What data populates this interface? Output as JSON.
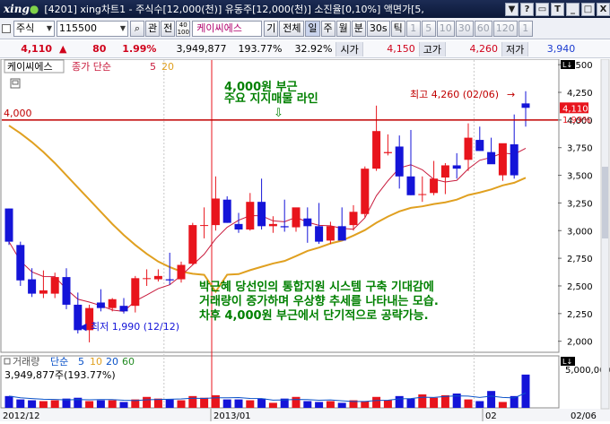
{
  "window": {
    "logo": "xing",
    "title": "[4201] xing차트1 - 주식수[12,000(천)] 유동주[12,000(천)] 소진율[0,10%] 액면가[5,",
    "buttons": [
      "▼",
      "?",
      "▭",
      "T",
      "_",
      "□",
      "X"
    ]
  },
  "toolbar": {
    "market": "주식",
    "code": "115500",
    "btn_related": "관",
    "btn_chart": "전",
    "stock_name": "케이씨에스",
    "btn_gi": "기",
    "btn_all": "전체",
    "periods": [
      "일",
      "주",
      "월",
      "분",
      "30s",
      "틱"
    ],
    "intervals": [
      "1",
      "5",
      "10",
      "30",
      "60",
      "120",
      "1"
    ],
    "count_top": "40",
    "count_bottom": "100"
  },
  "pricebar": {
    "price": "4,110",
    "arrow": "▲",
    "change": "80",
    "change_pct": "1.99%",
    "volume": "3,949,877",
    "vol_ratio": "193.77%",
    "ratio2": "32.92%",
    "open_label": "시가",
    "open": "4,150",
    "high_label": "고가",
    "high": "4,260",
    "low_label": "저가",
    "low": "3,940"
  },
  "chart_header": {
    "name": "케이씨에스",
    "ma_legend_label": "종가 단순",
    "ma_a": "5",
    "ma_b": "20"
  },
  "volume_header": {
    "label": "거래량",
    "ma_label": "단순",
    "ma": [
      "5",
      "10",
      "20",
      "60"
    ],
    "value": "3,949,877주(193.77%)"
  },
  "annotations": {
    "support_title": "4,000원 부근",
    "support_sub": "주요 지지매물 라인",
    "support_arrow": "⇩",
    "support_price": "4,000",
    "high_note": "최고 4,260 (02/06)",
    "low_note": "최저 1,990 (12/12)",
    "comment": [
      "박근혜 당선인의 통합지원 시스템 구축 기대감에",
      "거래량이 증가하며 우상향 추세를 나타내는 모습.",
      "차후 4,000원 부근에서 단기적으로 공략가능."
    ],
    "current_price_tag": "4,110",
    "current_pct_tag": "1.99%"
  },
  "axis": {
    "y_ticks": [
      "4,500",
      "4,250",
      "4,000",
      "3,750",
      "3,500",
      "3,250",
      "3,000",
      "2,750",
      "2,500",
      "2,250",
      "2,000"
    ],
    "vol_tick": "5,000,000",
    "x_ticks": [
      "2012/12",
      "2013/01",
      "02",
      "02/06"
    ]
  },
  "colors": {
    "up": "#e8141c",
    "down": "#1414d8",
    "ma5": "#c81a3c",
    "ma20": "#e0a020",
    "support_line": "#c00000",
    "annotation": "#008000"
  },
  "chart_data": {
    "type": "candlestick",
    "series": [
      {
        "name": "price",
        "ohlc": [
          [
            3200,
            3200,
            2870,
            2900
          ],
          [
            2870,
            2900,
            2500,
            2550
          ],
          [
            2560,
            2660,
            2400,
            2430
          ],
          [
            2430,
            2640,
            2390,
            2460
          ],
          [
            2430,
            2620,
            2390,
            2580
          ],
          [
            2580,
            2660,
            2290,
            2330
          ],
          [
            2330,
            2440,
            2070,
            2100
          ],
          [
            2100,
            2330,
            1990,
            2300
          ],
          [
            2350,
            2470,
            2270,
            2300
          ],
          [
            2300,
            2390,
            2270,
            2380
          ],
          [
            2320,
            2390,
            2250,
            2270
          ],
          [
            2320,
            2590,
            2260,
            2570
          ],
          [
            2570,
            2650,
            2500,
            2570
          ],
          [
            2560,
            2650,
            2540,
            2590
          ],
          [
            2560,
            2800,
            2510,
            2550
          ],
          [
            2560,
            2720,
            2530,
            2690
          ],
          [
            2700,
            3070,
            2690,
            3050
          ],
          [
            3050,
            3210,
            2930,
            3050
          ],
          [
            3050,
            3490,
            3000,
            3290
          ],
          [
            3280,
            3310,
            3070,
            3070
          ],
          [
            3060,
            3160,
            2980,
            3010
          ],
          [
            3010,
            3340,
            3000,
            3260
          ],
          [
            3260,
            3470,
            3010,
            3040
          ],
          [
            3040,
            3130,
            2980,
            3060
          ],
          [
            3040,
            3280,
            2990,
            3030
          ],
          [
            3030,
            3120,
            2990,
            3210
          ],
          [
            3110,
            3210,
            2890,
            3040
          ],
          [
            3040,
            3250,
            2880,
            2900
          ],
          [
            2910,
            3080,
            2880,
            3040
          ],
          [
            3040,
            3210,
            2920,
            2910
          ],
          [
            3050,
            3230,
            3000,
            3170
          ],
          [
            3150,
            3580,
            3120,
            3560
          ],
          [
            3560,
            4130,
            3540,
            3900
          ],
          [
            3700,
            3870,
            3680,
            3710
          ],
          [
            3760,
            3860,
            3380,
            3490
          ],
          [
            3490,
            3910,
            3320,
            3320
          ],
          [
            3330,
            3490,
            3260,
            3330
          ],
          [
            3340,
            3630,
            3320,
            3470
          ],
          [
            3480,
            3610,
            3330,
            3590
          ],
          [
            3590,
            3700,
            3470,
            3560
          ],
          [
            3640,
            3970,
            3540,
            3840
          ],
          [
            3820,
            3940,
            3720,
            3720
          ],
          [
            3710,
            3840,
            3630,
            3600
          ],
          [
            3500,
            3780,
            3450,
            3790
          ],
          [
            3780,
            4050,
            3470,
            3500
          ],
          [
            4150,
            4260,
            3940,
            4110
          ]
        ]
      },
      {
        "name": "volume",
        "values": [
          1.4,
          1.0,
          0.9,
          0.8,
          0.9,
          1.1,
          1.2,
          0.8,
          0.9,
          0.9,
          0.7,
          1.0,
          1.3,
          1.1,
          1.0,
          0.9,
          1.4,
          1.2,
          1.5,
          1.0,
          1.0,
          0.9,
          1.1,
          0.6,
          1.1,
          1.3,
          0.8,
          0.7,
          0.8,
          0.6,
          0.9,
          0.8,
          1.3,
          0.9,
          1.4,
          1.1,
          1.6,
          1.2,
          1.5,
          1.7,
          1.0,
          0.8,
          2.0,
          0.7,
          1.4,
          3.95
        ]
      }
    ],
    "ylim": [
      1900,
      4550
    ],
    "vol_ylim": [
      0,
      5.0
    ],
    "vol_unit": "million shares"
  }
}
